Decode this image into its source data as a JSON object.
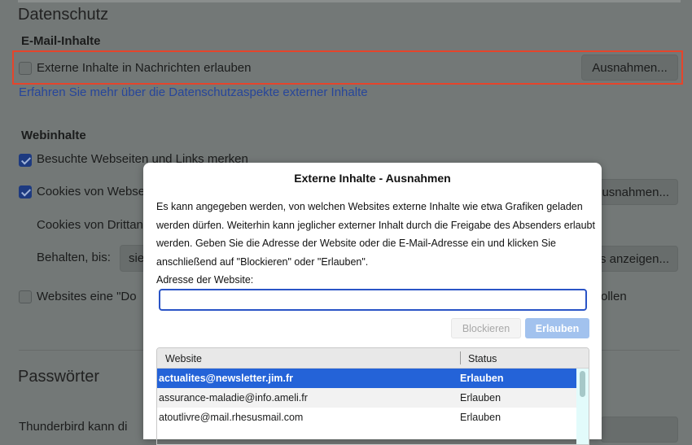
{
  "background": {
    "section_title": "Datenschutz",
    "email_heading": "E-Mail-Inhalte",
    "external_content_label": "Externe Inhalte in Nachrichten erlauben",
    "external_content_checked": false,
    "exceptions_button": "Ausnahmen...",
    "learn_more_link": "Erfahren Sie mehr über die Datenschutzaspekte externer Inhalte",
    "web_heading": "Webinhalte",
    "visited_label": "Besuchte Webseiten und Links merken",
    "cookies_label": "Cookies von Webse",
    "cookies_exceptions_button": "usnahmen...",
    "third_party_label": "Cookies von Drittan",
    "keep_label": "Behalten, bis:",
    "keep_value": "sie",
    "show_cookies_button": "s anzeigen...",
    "dnt_label": "Websites eine \"Do",
    "dnt_tail": "ollen",
    "passwords_title": "Passwörter",
    "bottom_text": "Thunderbird kann di"
  },
  "dialog": {
    "title": "Externe Inhalte - Ausnahmen",
    "description": "Es kann angegeben werden, von welchen Websites externe Inhalte wie etwa Grafiken geladen werden dürfen. Weiterhin kann jeglicher externer Inhalt durch die Freigabe des Absenders erlaubt werden. Geben Sie die Adresse der Website oder die E-Mail-Adresse ein und klicken Sie anschließend auf \"Blockieren\" oder \"Erlauben\".",
    "address_label": "Adresse der Website:",
    "address_value": "",
    "block_button": "Blockieren",
    "allow_button": "Erlauben",
    "columns": [
      "Website",
      "Status"
    ],
    "rows": [
      {
        "website": "actualites@newsletter.jim.fr",
        "status": "Erlauben"
      },
      {
        "website": "assurance-maladie@info.ameli.fr",
        "status": "Erlauben"
      },
      {
        "website": "atoutlivre@mail.rhesusmail.com",
        "status": "Erlauben"
      }
    ]
  }
}
